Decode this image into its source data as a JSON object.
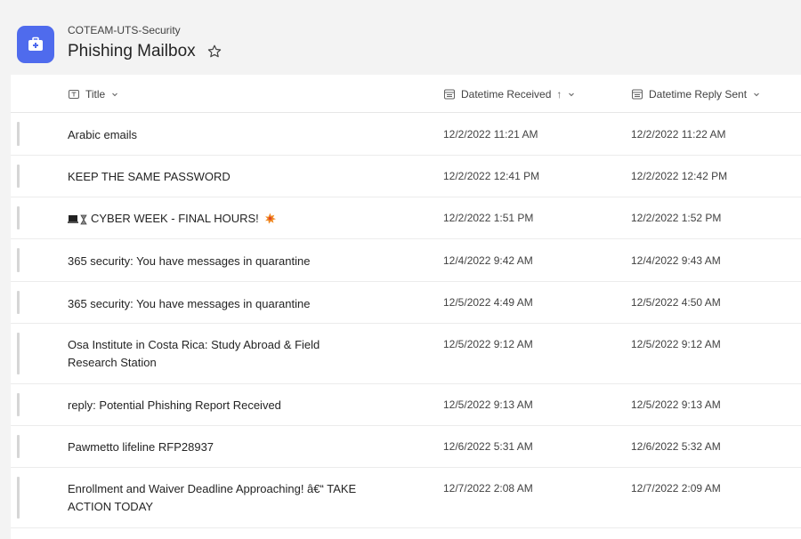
{
  "header": {
    "team": "COTEAM-UTS-Security",
    "title": "Phishing Mailbox"
  },
  "columns": {
    "title": "Title",
    "received": "Datetime Received",
    "received_sort": "↑",
    "reply": "Datetime Reply Sent"
  },
  "rows": [
    {
      "title": "Arabic emails",
      "received": "12/2/2022 11:21 AM",
      "reply": "12/2/2022 11:22 AM"
    },
    {
      "title": "KEEP THE SAME PASSWORD",
      "received": "12/2/2022 12:41 PM",
      "reply": "12/2/2022 12:42 PM"
    },
    {
      "title": "CYBER WEEK - FINAL HOURS!",
      "received": "12/2/2022 1:51 PM",
      "reply": "12/2/2022 1:52 PM"
    },
    {
      "title": "365 security: You have messages in quarantine",
      "received": "12/4/2022 9:42 AM",
      "reply": "12/4/2022 9:43 AM"
    },
    {
      "title": "365 security: You have messages in quarantine",
      "received": "12/5/2022 4:49 AM",
      "reply": "12/5/2022 4:50 AM"
    },
    {
      "title": "Osa Institute in Costa Rica: Study Abroad & Field Research Station",
      "received": "12/5/2022 9:12 AM",
      "reply": "12/5/2022 9:12 AM"
    },
    {
      "title": "reply: Potential Phishing Report Received",
      "received": "12/5/2022 9:13 AM",
      "reply": "12/5/2022 9:13 AM"
    },
    {
      "title": "Pawmetto lifeline RFP28937",
      "received": "12/6/2022 5:31 AM",
      "reply": "12/6/2022 5:32 AM"
    },
    {
      "title": "Enrollment and Waiver Deadline Approaching! â€“ TAKE ACTION TODAY",
      "received": "12/7/2022 2:08 AM",
      "reply": "12/7/2022 2:09 AM"
    }
  ]
}
